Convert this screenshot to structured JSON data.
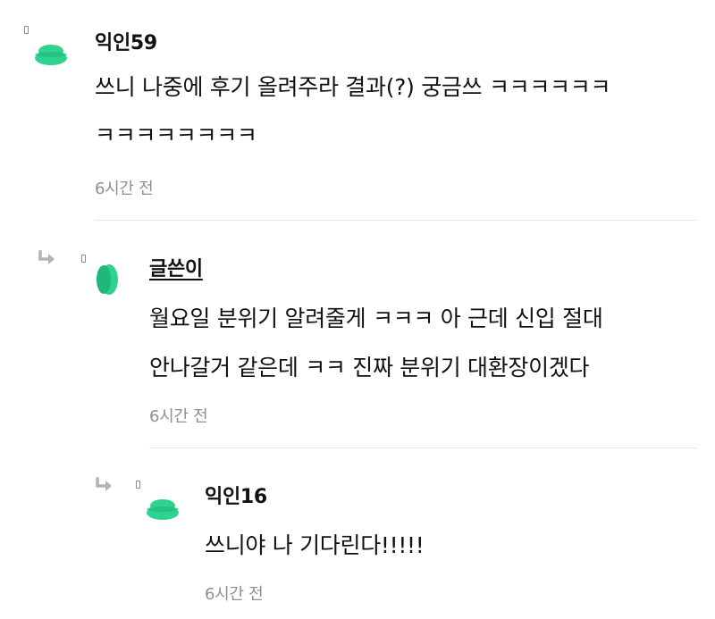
{
  "comments": [
    {
      "author": "익인59",
      "lines": [
        "쓰니 나중에 후기 올려주라 결과(?) 궁금쓰 ㅋㅋㅋㅋㅋㅋ",
        "ㅋㅋㅋㅋㅋㅋㅋㅋ"
      ],
      "time": "6시간 전",
      "avatar_icon": "green-disc-avatar-icon",
      "avatar_color": "#2fd38f"
    },
    {
      "author": "글쓴이",
      "lines": [
        "월요일 분위기 알려줄게 ㅋㅋㅋ 아 근데 신입 절대",
        "안나갈거 같은데 ㅋㅋ 진짜 분위기 대환장이겠다"
      ],
      "time": "6시간 전",
      "avatar_icon": "green-disc-avatar-icon",
      "avatar_color": "#2fd38f",
      "reply_icon": "reply-arrow-icon"
    },
    {
      "author": "익인16",
      "lines": [
        "쓰니야 나 기다린다!!!!!"
      ],
      "time": "6시간 전",
      "avatar_icon": "green-disc-avatar-icon",
      "avatar_color": "#2fd38f",
      "reply_icon": "reply-arrow-icon"
    }
  ],
  "colors": {
    "avatar_green": "#2fd38f",
    "avatar_green_dark": "#1fb87a",
    "text": "#111111",
    "muted": "#8f8f8f",
    "divider": "#e6e6e6",
    "arrow": "#b3b3b3"
  }
}
